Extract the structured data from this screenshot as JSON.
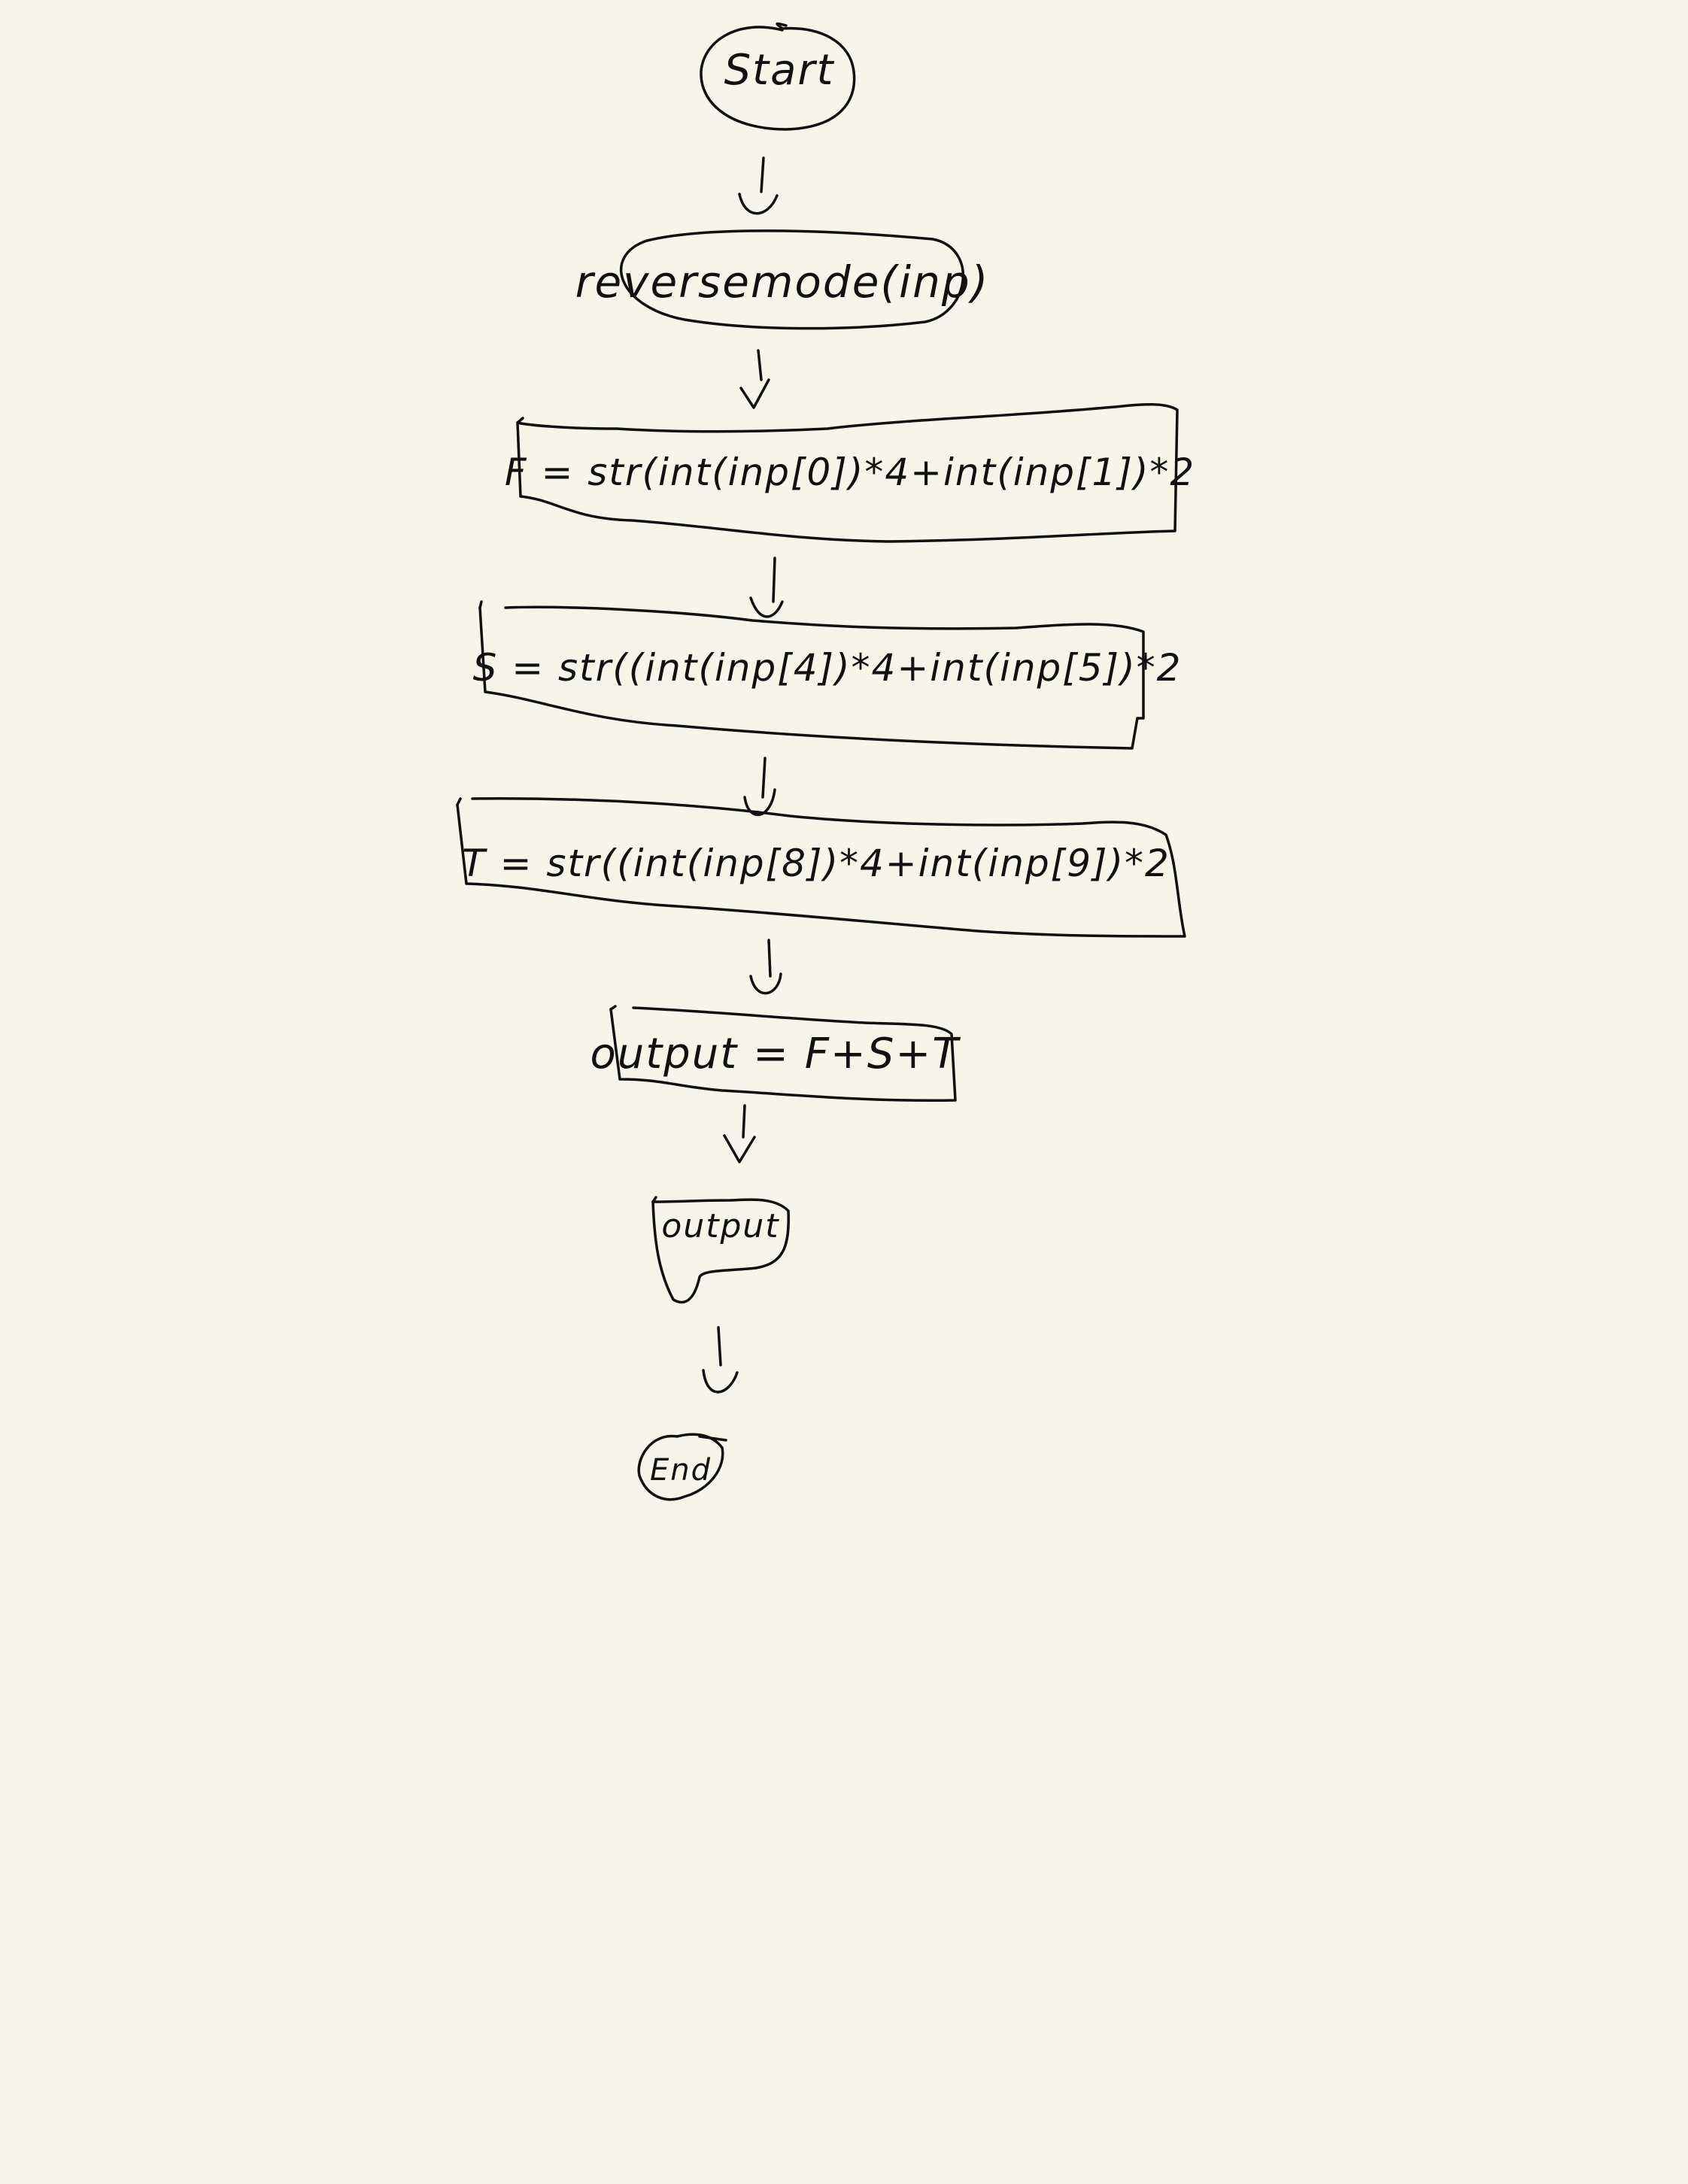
{
  "diagram": {
    "nodes": [
      {
        "id": "start",
        "shape": "terminator",
        "text": "Start"
      },
      {
        "id": "reverse",
        "shape": "terminator",
        "text": "reversemode(inp)"
      },
      {
        "id": "f",
        "shape": "process",
        "text": "F = str(int(inp[0])*4+int(inp[1])*2"
      },
      {
        "id": "s",
        "shape": "process",
        "text": "S = str((int(inp[4])*4+int(inp[5])*2"
      },
      {
        "id": "t",
        "shape": "process",
        "text": "T = str((int(inp[8])*4+int(inp[9])*2"
      },
      {
        "id": "out-assign",
        "shape": "process",
        "text": "output = F+S+T"
      },
      {
        "id": "output",
        "shape": "document",
        "text": "output"
      },
      {
        "id": "end",
        "shape": "terminator",
        "text": "End"
      }
    ],
    "edges": [
      [
        "start",
        "reverse"
      ],
      [
        "reverse",
        "f"
      ],
      [
        "f",
        "s"
      ],
      [
        "s",
        "t"
      ],
      [
        "t",
        "out-assign"
      ],
      [
        "out-assign",
        "output"
      ],
      [
        "output",
        "end"
      ]
    ]
  }
}
